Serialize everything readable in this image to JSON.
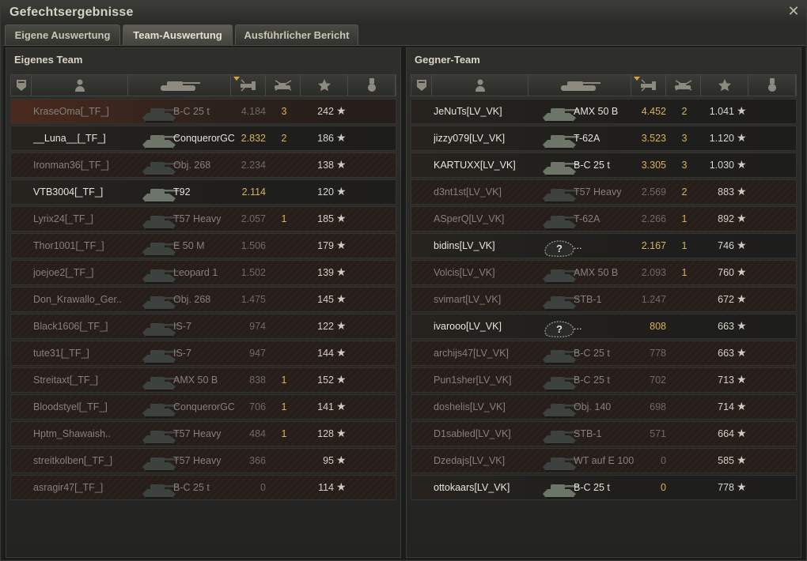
{
  "window": {
    "title": "Gefechtsergebnisse",
    "close_icon": "close-icon"
  },
  "tabs": [
    {
      "label": "Eigene Auswertung",
      "active": false
    },
    {
      "label": "Team-Auswertung",
      "active": true
    },
    {
      "label": "Ausführlicher Bericht",
      "active": false
    }
  ],
  "colors": {
    "gold": "#d9b25a",
    "dead_text": "#85807a",
    "alive_text": "#e7e4da"
  },
  "header_icons": [
    "platoon-icon",
    "player-icon",
    "vehicle-icon",
    "damage-icon",
    "kills-icon",
    "xp-star-icon",
    "medal-icon"
  ],
  "own_team": {
    "title": "Eigenes Team",
    "rows": [
      {
        "player": "KraseOma[_TF_]",
        "tank": "B-C 25 t",
        "damage": "4.184",
        "kills": "3",
        "xp": "242",
        "dead": true,
        "tank_icon": "tank-icon"
      },
      {
        "player": "__Luna__[_TF_]",
        "tank": "ConquerorGC",
        "damage": "2.832",
        "kills": "2",
        "xp": "186",
        "dead": false,
        "tank_icon": "tank-icon"
      },
      {
        "player": "Ironman36[_TF_]",
        "tank": "Obj. 268",
        "damage": "2.234",
        "kills": "",
        "xp": "138",
        "dead": true,
        "tank_icon": "tank-icon"
      },
      {
        "player": "VTB3004[_TF_]",
        "tank": "T92",
        "damage": "2.114",
        "kills": "",
        "xp": "120",
        "dead": false,
        "tank_icon": "tank-icon"
      },
      {
        "player": "Lyrix24[_TF_]",
        "tank": "T57 Heavy",
        "damage": "2.057",
        "kills": "1",
        "xp": "185",
        "dead": true,
        "tank_icon": "tank-icon"
      },
      {
        "player": "Thor1001[_TF_]",
        "tank": "E 50 M",
        "damage": "1.506",
        "kills": "",
        "xp": "179",
        "dead": true,
        "tank_icon": "tank-icon"
      },
      {
        "player": "joejoe2[_TF_]",
        "tank": "Leopard 1",
        "damage": "1.502",
        "kills": "",
        "xp": "139",
        "dead": true,
        "tank_icon": "tank-icon"
      },
      {
        "player": "Don_Krawallo_Ger..",
        "tank": "Obj. 268",
        "damage": "1.475",
        "kills": "",
        "xp": "145",
        "dead": true,
        "tank_icon": "tank-icon"
      },
      {
        "player": "Black1606[_TF_]",
        "tank": "IS-7",
        "damage": "974",
        "kills": "",
        "xp": "122",
        "dead": true,
        "tank_icon": "tank-icon"
      },
      {
        "player": "tute31[_TF_]",
        "tank": "IS-7",
        "damage": "947",
        "kills": "",
        "xp": "144",
        "dead": true,
        "tank_icon": "tank-icon"
      },
      {
        "player": "Streitaxt[_TF_]",
        "tank": "AMX 50 B",
        "damage": "838",
        "kills": "1",
        "xp": "152",
        "dead": true,
        "tank_icon": "tank-icon"
      },
      {
        "player": "Bloodstyel[_TF_]",
        "tank": "ConquerorGC",
        "damage": "706",
        "kills": "1",
        "xp": "141",
        "dead": true,
        "tank_icon": "tank-icon"
      },
      {
        "player": "Hptm_Shawaish..",
        "tank": "T57 Heavy",
        "damage": "484",
        "kills": "1",
        "xp": "128",
        "dead": true,
        "tank_icon": "tank-icon"
      },
      {
        "player": "streitkolben[_TF_]",
        "tank": "T57 Heavy",
        "damage": "366",
        "kills": "",
        "xp": "95",
        "dead": true,
        "tank_icon": "tank-icon"
      },
      {
        "player": "asragir47[_TF_]",
        "tank": "B-C 25 t",
        "damage": "0",
        "kills": "",
        "xp": "114",
        "dead": true,
        "tank_icon": "tank-icon"
      }
    ]
  },
  "enemy_team": {
    "title": "Gegner-Team",
    "rows": [
      {
        "player": "JeNuTs[LV_VK]",
        "tank": "AMX 50 B",
        "damage": "4.452",
        "kills": "2",
        "xp": "1.041",
        "dead": false,
        "tank_icon": "tank-icon"
      },
      {
        "player": "jizzy079[LV_VK]",
        "tank": "T-62A",
        "damage": "3.523",
        "kills": "3",
        "xp": "1.120",
        "dead": false,
        "tank_icon": "tank-icon"
      },
      {
        "player": "KARTUXX[LV_VK]",
        "tank": "B-C 25 t",
        "damage": "3.305",
        "kills": "3",
        "xp": "1.030",
        "dead": false,
        "tank_icon": "tank-icon"
      },
      {
        "player": "d3nt1st[LV_VK]",
        "tank": "T57 Heavy",
        "damage": "2.569",
        "kills": "2",
        "xp": "883",
        "dead": true,
        "tank_icon": "tank-icon"
      },
      {
        "player": "ASperQ[LV_VK]",
        "tank": "T-62A",
        "damage": "2.266",
        "kills": "1",
        "xp": "892",
        "dead": true,
        "tank_icon": "tank-icon"
      },
      {
        "player": "bidins[LV_VK]",
        "tank": "...",
        "damage": "2.167",
        "kills": "1",
        "xp": "746",
        "dead": false,
        "tank_icon": "unknown-tank-icon"
      },
      {
        "player": "Volcis[LV_VK]",
        "tank": "AMX 50 B",
        "damage": "2.093",
        "kills": "1",
        "xp": "760",
        "dead": true,
        "tank_icon": "tank-icon"
      },
      {
        "player": "svimart[LV_VK]",
        "tank": "STB-1",
        "damage": "1.247",
        "kills": "",
        "xp": "672",
        "dead": true,
        "tank_icon": "tank-icon"
      },
      {
        "player": "ivarooo[LV_VK]",
        "tank": "...",
        "damage": "808",
        "kills": "",
        "xp": "663",
        "dead": false,
        "tank_icon": "unknown-tank-icon"
      },
      {
        "player": "archijs47[LV_VK]",
        "tank": "B-C 25 t",
        "damage": "778",
        "kills": "",
        "xp": "663",
        "dead": true,
        "tank_icon": "tank-icon"
      },
      {
        "player": "Pun1sher[LV_VK]",
        "tank": "B-C 25 t",
        "damage": "702",
        "kills": "",
        "xp": "713",
        "dead": true,
        "tank_icon": "tank-icon"
      },
      {
        "player": "doshelis[LV_VK]",
        "tank": "Obj. 140",
        "damage": "698",
        "kills": "",
        "xp": "714",
        "dead": true,
        "tank_icon": "tank-icon"
      },
      {
        "player": "D1sabled[LV_VK]",
        "tank": "STB-1",
        "damage": "571",
        "kills": "",
        "xp": "664",
        "dead": true,
        "tank_icon": "tank-icon"
      },
      {
        "player": "Dzedajs[LV_VK]",
        "tank": "WT auf E 100",
        "damage": "0",
        "kills": "",
        "xp": "585",
        "dead": true,
        "tank_icon": "tank-icon"
      },
      {
        "player": "ottokaars[LV_VK]",
        "tank": "B-C 25 t",
        "damage": "0",
        "kills": "",
        "xp": "778",
        "dead": false,
        "tank_icon": "tank-icon"
      }
    ]
  }
}
